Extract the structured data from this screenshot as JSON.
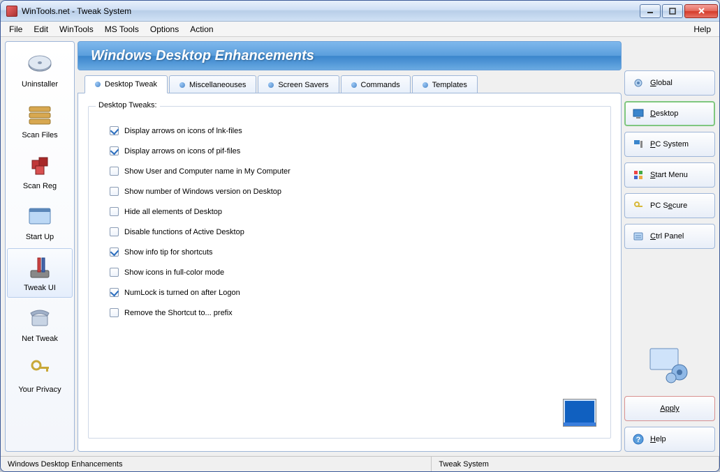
{
  "window": {
    "title": "WinTools.net - Tweak System"
  },
  "menubar": {
    "items": [
      "File",
      "Edit",
      "WinTools",
      "MS Tools",
      "Options",
      "Action"
    ],
    "help": "Help"
  },
  "sidebar_left": [
    {
      "label": "Uninstaller",
      "icon": "disc"
    },
    {
      "label": "Scan Files",
      "icon": "drives"
    },
    {
      "label": "Scan Reg",
      "icon": "cubes"
    },
    {
      "label": "Start Up",
      "icon": "window"
    },
    {
      "label": "Tweak UI",
      "icon": "tools",
      "selected": true
    },
    {
      "label": "Net Tweak",
      "icon": "phone"
    },
    {
      "label": "Your Privacy",
      "icon": "keys"
    }
  ],
  "header": "Windows Desktop Enhancements",
  "tabs": [
    "Desktop Tweak",
    "Miscellaneouses",
    "Screen Savers",
    "Commands",
    "Templates"
  ],
  "active_tab": 0,
  "fieldset_title": "Desktop Tweaks:",
  "tweaks": [
    {
      "label": "Display arrows on icons of lnk-files",
      "checked": true
    },
    {
      "label": "Display arrows on icons of pif-files",
      "checked": true
    },
    {
      "label": "Show User and Computer name in My Computer",
      "checked": false
    },
    {
      "label": "Show number of Windows version on Desktop",
      "checked": false
    },
    {
      "label": "Hide all elements of Desktop",
      "checked": false
    },
    {
      "label": "Disable functions of Active Desktop",
      "checked": false
    },
    {
      "label": "Show info tip for shortcuts",
      "checked": true
    },
    {
      "label": "Show icons in full-color mode",
      "checked": false
    },
    {
      "label": "NumLock is turned on after Logon",
      "checked": true
    },
    {
      "label": "Remove the Shortcut to... prefix",
      "checked": false
    }
  ],
  "sidebar_right": [
    {
      "label": "Global",
      "icon": "gear",
      "key": "G"
    },
    {
      "label": "Desktop",
      "icon": "desktop",
      "key": "D",
      "selected": true
    },
    {
      "label": "PC System",
      "icon": "pc",
      "key": "P"
    },
    {
      "label": "Start Menu",
      "icon": "start",
      "key": "S"
    },
    {
      "label": "PC Secure",
      "icon": "secure",
      "key": "e"
    },
    {
      "label": "Ctrl Panel",
      "icon": "panel",
      "key": "C"
    }
  ],
  "apply_label": "Apply",
  "help_label": "Help",
  "statusbar": {
    "left": "Windows Desktop Enhancements",
    "right": "Tweak System"
  }
}
